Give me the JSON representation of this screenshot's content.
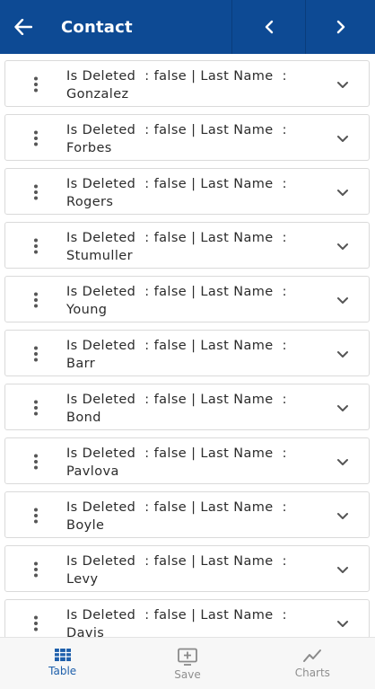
{
  "header": {
    "title": "Contact"
  },
  "records": [
    {
      "line1": "Is Deleted  : false | Last Name  :",
      "line2": "Gonzalez"
    },
    {
      "line1": "Is Deleted  : false | Last Name  :",
      "line2": "Forbes"
    },
    {
      "line1": "Is Deleted  : false | Last Name  :",
      "line2": "Rogers"
    },
    {
      "line1": "Is Deleted  : false | Last Name  :",
      "line2": "Stumuller"
    },
    {
      "line1": "Is Deleted  : false | Last Name  :",
      "line2": "Young"
    },
    {
      "line1": "Is Deleted  : false | Last Name  :",
      "line2": "Barr"
    },
    {
      "line1": "Is Deleted  : false | Last Name  :",
      "line2": "Bond"
    },
    {
      "line1": "Is Deleted  : false | Last Name  :",
      "line2": "Pavlova"
    },
    {
      "line1": "Is Deleted  : false | Last Name  :",
      "line2": "Boyle"
    },
    {
      "line1": "Is Deleted  : false | Last Name  :",
      "line2": "Levy"
    },
    {
      "line1": "Is Deleted  : false | Last Name  :",
      "line2": "Davis"
    }
  ],
  "bottom_nav": {
    "table_label": "Table",
    "save_label": "Save",
    "charts_label": "Charts",
    "active": "table"
  },
  "colors": {
    "header_bg": "#0d4a94",
    "active_tab": "#1e5fab",
    "inactive_tab": "#8f8f8f"
  }
}
